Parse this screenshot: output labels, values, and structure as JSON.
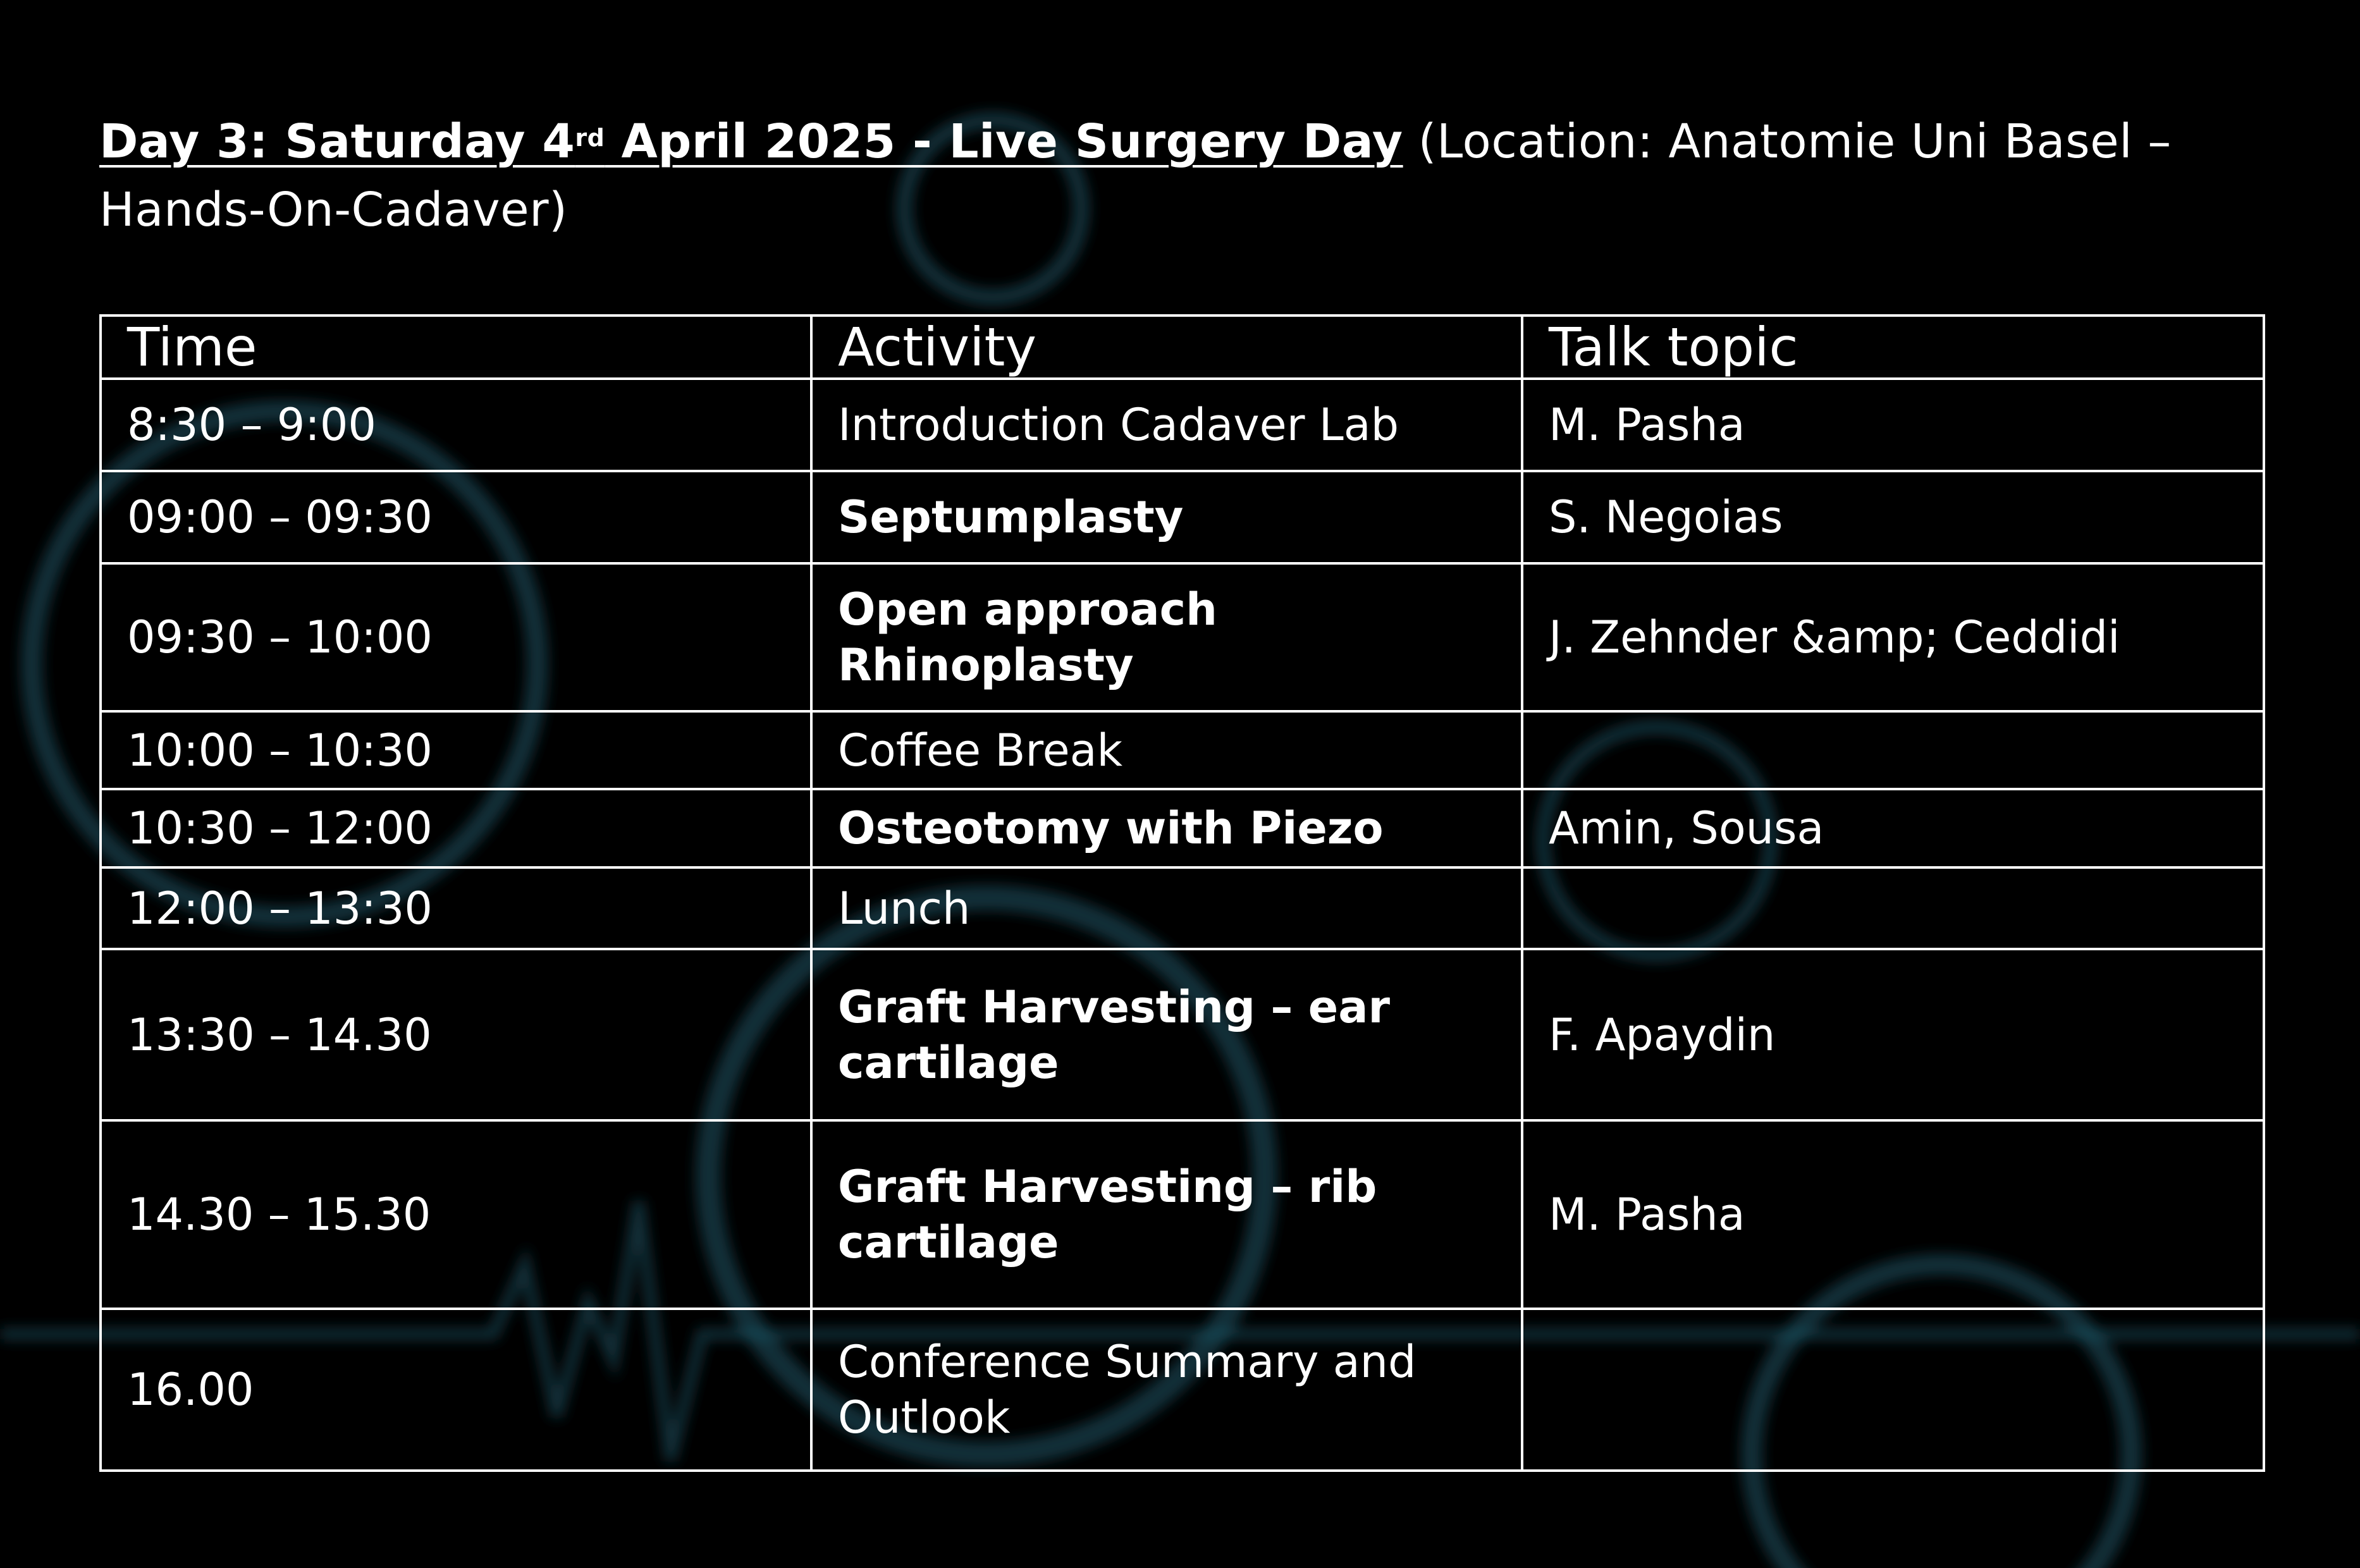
{
  "heading": {
    "part1": "Day 3: Saturday 4",
    "sup": "rd",
    "part2": " April 2025 - Live Surgery Day",
    "location": " (Location: Anatomie Uni Basel – Hands-On-Cadaver)"
  },
  "table": {
    "headers": {
      "time": "Time",
      "activity": "Activity",
      "topic": "Talk topic"
    },
    "rows": [
      {
        "time": "8:30 – 9:00",
        "activity": "Introduction Cadaver Lab",
        "topic": "M. Pasha"
      },
      {
        "time": "09:00 – 09:30",
        "activity": "Septumplasty",
        "topic": "S. Negoias"
      },
      {
        "time": "09:30 – 10:00",
        "activity": "Open approach Rhinoplasty",
        "topic": "J. Zehnder &amp; Ceddidi"
      },
      {
        "time": "10:00 – 10:30",
        "activity": "Coffee Break",
        "topic": ""
      },
      {
        "time": "10:30 – 12:00",
        "activity": "Osteotomy with Piezo",
        "topic": "Amin, Sousa"
      },
      {
        "time": "12:00 – 13:30",
        "activity": "Lunch",
        "topic": ""
      },
      {
        "time": "13:30 – 14.30",
        "activity": "Graft Harvesting – ear cartilage",
        "topic": "F. Apaydin"
      },
      {
        "time": "14.30 – 15.30",
        "activity": "Graft Harvesting – rib cartilage",
        "topic": "M. Pasha"
      },
      {
        "time": "16.00",
        "activity": "Conference Summary and Outlook",
        "topic": ""
      }
    ]
  },
  "colors": {
    "background": "#000000",
    "text": "#ffffff",
    "glow": "#1a4a5a"
  }
}
